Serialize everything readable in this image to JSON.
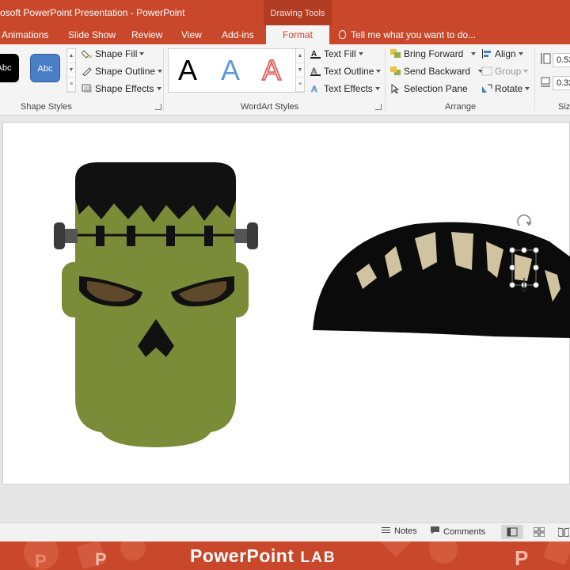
{
  "title": "osoft PowerPoint Presentation - PowerPoint",
  "contextual_tab_group": "Drawing Tools",
  "tabs": [
    {
      "label": "Animations"
    },
    {
      "label": "Slide Show"
    },
    {
      "label": "Review"
    },
    {
      "label": "View"
    },
    {
      "label": "Add-ins"
    },
    {
      "label": "Format",
      "active": true
    }
  ],
  "tell_me": "Tell me what you want to do...",
  "ribbon": {
    "shape_styles": {
      "label": "Shape Styles",
      "swatches": [
        {
          "text": "Abc",
          "color": "#000000"
        },
        {
          "text": "Abc",
          "color": "#4a7fc8"
        }
      ],
      "fill": "Shape Fill",
      "outline": "Shape Outline",
      "effects": "Shape Effects"
    },
    "wordart_styles": {
      "label": "WordArt Styles",
      "samples": [
        "A",
        "A",
        "A"
      ],
      "text_fill": "Text Fill",
      "text_outline": "Text Outline",
      "text_effects": "Text Effects"
    },
    "arrange": {
      "label": "Arrange",
      "bring_forward": "Bring Forward",
      "send_backward": "Send Backward",
      "selection_pane": "Selection Pane",
      "align": "Align",
      "group": "Group",
      "rotate": "Rotate"
    },
    "size": {
      "label": "Siz",
      "height": "0.53",
      "width": "0.32"
    }
  },
  "statusbar": {
    "notes": "Notes",
    "comments": "Comments"
  },
  "banner": {
    "title": "PowerPoint",
    "suffix": "LAB"
  },
  "colors": {
    "brand": "#c9472b",
    "face_green": "#7a8c38",
    "hair": "#111111",
    "eyes": "#5e4a2a",
    "teeth": "#cfc3a0"
  },
  "icons": [
    "lightbulb-icon",
    "shape-fill-icon",
    "shape-outline-icon",
    "shape-effects-icon",
    "text-fill-icon",
    "text-outline-icon",
    "text-effects-icon",
    "bring-forward-icon",
    "send-backward-icon",
    "selection-pane-icon",
    "align-icon",
    "group-icon",
    "rotate-icon",
    "notes-icon",
    "comments-icon",
    "normal-view-icon",
    "slide-sorter-icon",
    "rotation-handle-icon"
  ]
}
